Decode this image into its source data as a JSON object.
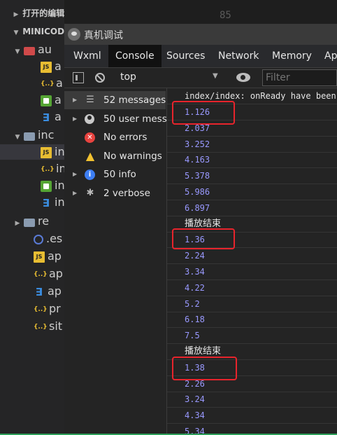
{
  "editor": {
    "line_number": "85"
  },
  "explorer": {
    "open_editors_label": "打开的编辑器",
    "project_label": "MINICODE",
    "items": [
      {
        "name": "au",
        "type": "folder-red"
      },
      {
        "name": "a",
        "type": "js"
      },
      {
        "name": "a",
        "type": "json"
      },
      {
        "name": "a",
        "type": "wxml"
      },
      {
        "name": "a",
        "type": "wxss"
      },
      {
        "name": "inc",
        "type": "folder"
      },
      {
        "name": "in",
        "type": "js"
      },
      {
        "name": "in",
        "type": "json"
      },
      {
        "name": "in",
        "type": "wxml"
      },
      {
        "name": "in",
        "type": "wxss"
      },
      {
        "name": "re",
        "type": "folder"
      },
      {
        "name": ".es",
        "type": "es"
      },
      {
        "name": "ap",
        "type": "js"
      },
      {
        "name": "ap",
        "type": "json"
      },
      {
        "name": "ap",
        "type": "wxss"
      },
      {
        "name": "pr",
        "type": "json"
      },
      {
        "name": "sit",
        "type": "json"
      }
    ]
  },
  "devtools": {
    "window_title": "真机调试",
    "tabs": [
      "Wxml",
      "Console",
      "Sources",
      "Network",
      "Memory",
      "Ap"
    ],
    "active_tab": "Console",
    "context": "top",
    "filter_placeholder": "Filter"
  },
  "sidebar": {
    "items": [
      {
        "label": "52 messages",
        "icon": "list-icon"
      },
      {
        "label": "50 user mess...",
        "icon": "user-icon"
      },
      {
        "label": "No errors",
        "icon": "error-icon"
      },
      {
        "label": "No warnings",
        "icon": "warning-icon"
      },
      {
        "label": "50 info",
        "icon": "info-icon"
      },
      {
        "label": "2 verbose",
        "icon": "bug-icon"
      }
    ]
  },
  "console": {
    "header": "index/index: onReady have been",
    "lines": [
      {
        "text": "1.126",
        "kind": "num"
      },
      {
        "text": "2.037",
        "kind": "num"
      },
      {
        "text": "3.252",
        "kind": "num"
      },
      {
        "text": "4.163",
        "kind": "num"
      },
      {
        "text": "5.378",
        "kind": "num"
      },
      {
        "text": "5.986",
        "kind": "num"
      },
      {
        "text": "6.897",
        "kind": "num"
      },
      {
        "text": "播放结束",
        "kind": "text"
      },
      {
        "text": "1.36",
        "kind": "num"
      },
      {
        "text": "2.24",
        "kind": "num"
      },
      {
        "text": "3.34",
        "kind": "num"
      },
      {
        "text": "4.22",
        "kind": "num"
      },
      {
        "text": "5.2",
        "kind": "num"
      },
      {
        "text": "6.18",
        "kind": "num"
      },
      {
        "text": "7.5",
        "kind": "num"
      },
      {
        "text": "播放结束",
        "kind": "text"
      },
      {
        "text": "1.38",
        "kind": "num"
      },
      {
        "text": "2.26",
        "kind": "num"
      },
      {
        "text": "3.24",
        "kind": "num"
      },
      {
        "text": "4.34",
        "kind": "num"
      },
      {
        "text": "5.34",
        "kind": "num"
      }
    ]
  },
  "colors": {
    "highlight": "#e8242c",
    "number": "#9999ff",
    "accent_bottom": "#2ea05a"
  }
}
